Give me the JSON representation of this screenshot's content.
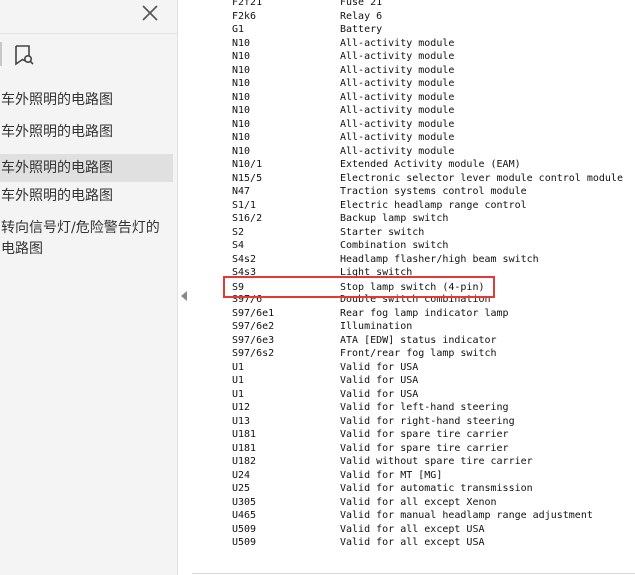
{
  "sidebar": {
    "bookmarks": [
      {
        "label": "车外照明的电路图",
        "selected": false
      },
      {
        "label": "车外照明的电路图",
        "selected": false
      },
      {
        "label": "车外照明的电路图",
        "selected": true
      },
      {
        "label": "车外照明的电路图",
        "selected": false
      },
      {
        "label": "转向信号灯/危险警告灯的电路图",
        "selected": false
      }
    ]
  },
  "document": {
    "rows": [
      {
        "code": "F2f21",
        "description": "Fuse 21"
      },
      {
        "code": "F2k6",
        "description": "Relay 6"
      },
      {
        "code": "G1",
        "description": "Battery"
      },
      {
        "code": "N10",
        "description": "All-activity module"
      },
      {
        "code": "N10",
        "description": "All-activity module"
      },
      {
        "code": "N10",
        "description": "All-activity module"
      },
      {
        "code": "N10",
        "description": "All-activity module"
      },
      {
        "code": "N10",
        "description": "All-activity module"
      },
      {
        "code": "N10",
        "description": "All-activity module"
      },
      {
        "code": "N10",
        "description": "All-activity module"
      },
      {
        "code": "N10",
        "description": "All-activity module"
      },
      {
        "code": "N10",
        "description": "All-activity module"
      },
      {
        "code": "N10/1",
        "description": "Extended Activity module (EAM)"
      },
      {
        "code": "N15/5",
        "description": "Electronic selector lever module control module"
      },
      {
        "code": "N47",
        "description": "Traction systems control module"
      },
      {
        "code": "S1/1",
        "description": "Electric headlamp range control"
      },
      {
        "code": "S16/2",
        "description": "Backup lamp switch"
      },
      {
        "code": "S2",
        "description": "Starter switch"
      },
      {
        "code": "S4",
        "description": "Combination switch"
      },
      {
        "code": "S4s2",
        "description": "Headlamp flasher/high beam switch"
      },
      {
        "code": "S4s3",
        "description": "Light switch"
      },
      {
        "code": "S9",
        "description": "Stop lamp switch (4-pin)"
      },
      {
        "code": "S97/6",
        "description": "Double switch combination"
      },
      {
        "code": "S97/6e1",
        "description": "Rear fog lamp indicator lamp"
      },
      {
        "code": "S97/6e2",
        "description": "Illumination"
      },
      {
        "code": "S97/6e3",
        "description": "ATA [EDW] status indicator"
      },
      {
        "code": "S97/6s2",
        "description": "Front/rear fog lamp switch"
      },
      {
        "code": "U1",
        "description": "Valid for USA"
      },
      {
        "code": "U1",
        "description": "Valid for USA"
      },
      {
        "code": "U1",
        "description": "Valid for USA"
      },
      {
        "code": "U12",
        "description": "Valid for left-hand steering"
      },
      {
        "code": "U13",
        "description": "Valid for right-hand steering"
      },
      {
        "code": "U181",
        "description": "Valid for spare tire carrier"
      },
      {
        "code": "U181",
        "description": "Valid for spare tire carrier"
      },
      {
        "code": "U182",
        "description": "Valid without spare tire carrier"
      },
      {
        "code": "U24",
        "description": "Valid for MT [MG]"
      },
      {
        "code": "U25",
        "description": "Valid for automatic transmission"
      },
      {
        "code": "U305",
        "description": "Valid for all except Xenon"
      },
      {
        "code": "U465",
        "description": "Valid for manual headlamp range adjustment"
      },
      {
        "code": "U509",
        "description": "Valid for all except USA"
      },
      {
        "code": "U509",
        "description": "Valid for all except USA"
      }
    ]
  },
  "colors": {
    "highlight_border": "#e53935",
    "sidebar_bg": "#f4f4f4",
    "selected_bg": "#e0e0e0"
  }
}
